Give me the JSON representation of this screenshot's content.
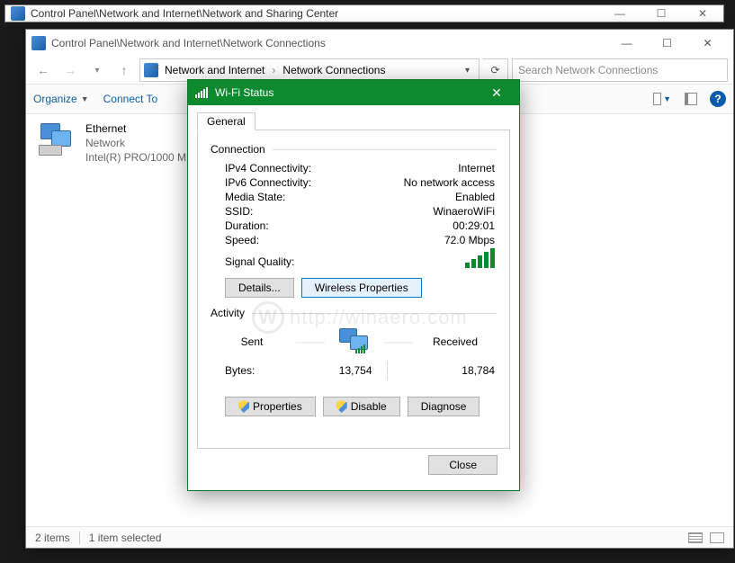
{
  "bgWindow": {
    "title": "Control Panel\\Network and Internet\\Network and Sharing Center"
  },
  "frontWindow": {
    "title": "Control Panel\\Network and Internet\\Network Connections",
    "breadcrumb": {
      "a": "Network and Internet",
      "b": "Network Connections"
    },
    "searchPlaceholder": "Search Network Connections",
    "toolbar": {
      "organize": "Organize",
      "connectTo": "Connect To"
    },
    "adapter": {
      "name": "Ethernet",
      "status": "Network",
      "device": "Intel(R) PRO/1000 M"
    },
    "statusbar": {
      "items": "2 items",
      "selected": "1 item selected"
    }
  },
  "dialog": {
    "title": "Wi-Fi Status",
    "tab": "General",
    "groups": {
      "connection": "Connection",
      "activity": "Activity"
    },
    "fields": {
      "ipv4_k": "IPv4 Connectivity:",
      "ipv4_v": "Internet",
      "ipv6_k": "IPv6 Connectivity:",
      "ipv6_v": "No network access",
      "media_k": "Media State:",
      "media_v": "Enabled",
      "ssid_k": "SSID:",
      "ssid_v": "WinaeroWiFi",
      "dur_k": "Duration:",
      "dur_v": "00:29:01",
      "speed_k": "Speed:",
      "speed_v": "72.0 Mbps",
      "sigq_k": "Signal Quality:"
    },
    "buttons": {
      "details": "Details...",
      "wprops": "Wireless Properties",
      "properties": "Properties",
      "disable": "Disable",
      "diagnose": "Diagnose",
      "close": "Close"
    },
    "activity": {
      "sent_label": "Sent",
      "received_label": "Received",
      "bytes_label": "Bytes:",
      "sent_v": "13,754",
      "recv_v": "18,784"
    }
  },
  "watermark": "http://winaero.com"
}
